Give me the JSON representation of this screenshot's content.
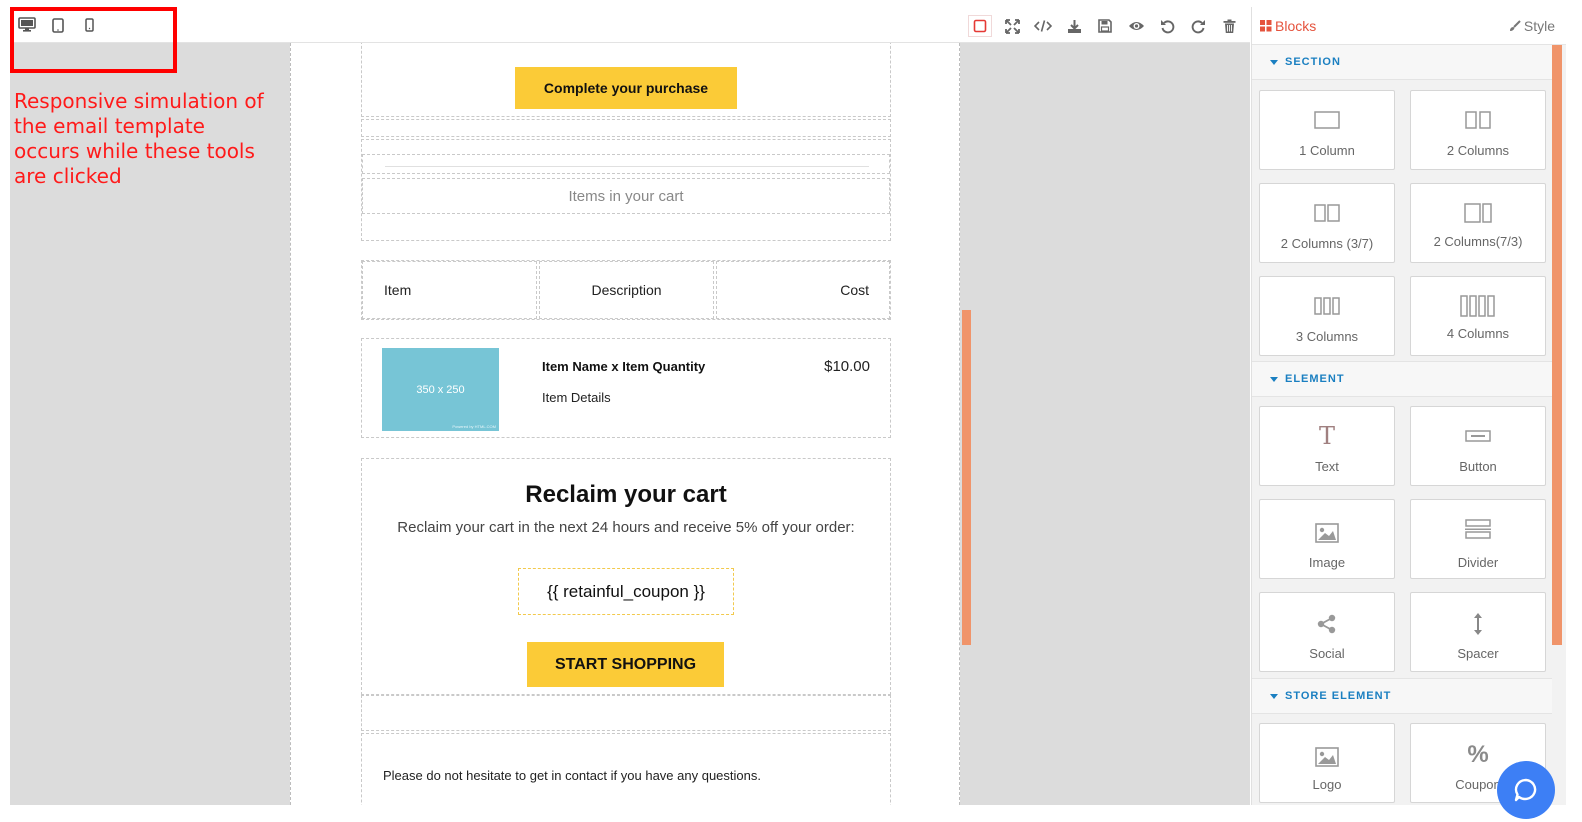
{
  "annotation": {
    "text": "Responsive simulation of the email template occurs while these tools are clicked"
  },
  "toolbar": {
    "devices": [
      "desktop-icon",
      "tablet-icon",
      "mobile-icon"
    ],
    "tools": [
      "border-toggle-icon",
      "fullscreen-icon",
      "code-icon",
      "download-icon",
      "save-icon",
      "preview-icon",
      "undo-icon",
      "redo-icon",
      "trash-icon"
    ]
  },
  "email": {
    "purchase_button": "Complete your purchase",
    "cart_heading": "Items in your cart",
    "table_headers": {
      "item": "Item",
      "description": "Description",
      "cost": "Cost"
    },
    "item": {
      "image_label": "350 x 250",
      "image_credit": "Powered by HTML.COM",
      "name": "Item Name x Item Quantity",
      "details": "Item Details",
      "price": "$10.00"
    },
    "reclaim": {
      "title": "Reclaim your cart",
      "text": "Reclaim your cart in the next 24 hours and receive 5% off your order:",
      "coupon": "{{ retainful_coupon }}",
      "button": "START SHOPPING"
    },
    "footer_text": "Please do not hesitate to get in contact if you have any questions."
  },
  "panel": {
    "tab_blocks": "Blocks",
    "tab_style": "Style",
    "sections": {
      "section": {
        "title": "SECTION",
        "blocks": [
          {
            "label": "1 Column",
            "icon": "one-column-icon"
          },
          {
            "label": "2 Columns",
            "icon": "two-columns-icon"
          },
          {
            "label": "2 Columns (3/7)",
            "icon": "two-columns-37-icon"
          },
          {
            "label": "2 Columns(7/3)",
            "icon": "two-columns-73-icon"
          },
          {
            "label": "3 Columns",
            "icon": "three-columns-icon"
          },
          {
            "label": "4 Columns",
            "icon": "four-columns-icon"
          }
        ]
      },
      "element": {
        "title": "ELEMENT",
        "blocks": [
          {
            "label": "Text",
            "icon": "text-icon"
          },
          {
            "label": "Button",
            "icon": "button-icon"
          },
          {
            "label": "Image",
            "icon": "image-icon"
          },
          {
            "label": "Divider",
            "icon": "divider-icon"
          },
          {
            "label": "Social",
            "icon": "share-icon"
          },
          {
            "label": "Spacer",
            "icon": "spacer-icon"
          }
        ]
      },
      "store": {
        "title": "STORE ELEMENT",
        "blocks": [
          {
            "label": "Logo",
            "icon": "logo-image-icon"
          },
          {
            "label": "Coupon",
            "icon": "percent-icon"
          }
        ]
      }
    }
  },
  "colors": {
    "accent_yellow": "#fbcb37",
    "panel_accent": "#1a7fc1",
    "scroll_orange": "#f0946a",
    "blocks_red": "#e5533d",
    "annotation_red": "#ff0000",
    "help_blue": "#3d7ff5"
  }
}
